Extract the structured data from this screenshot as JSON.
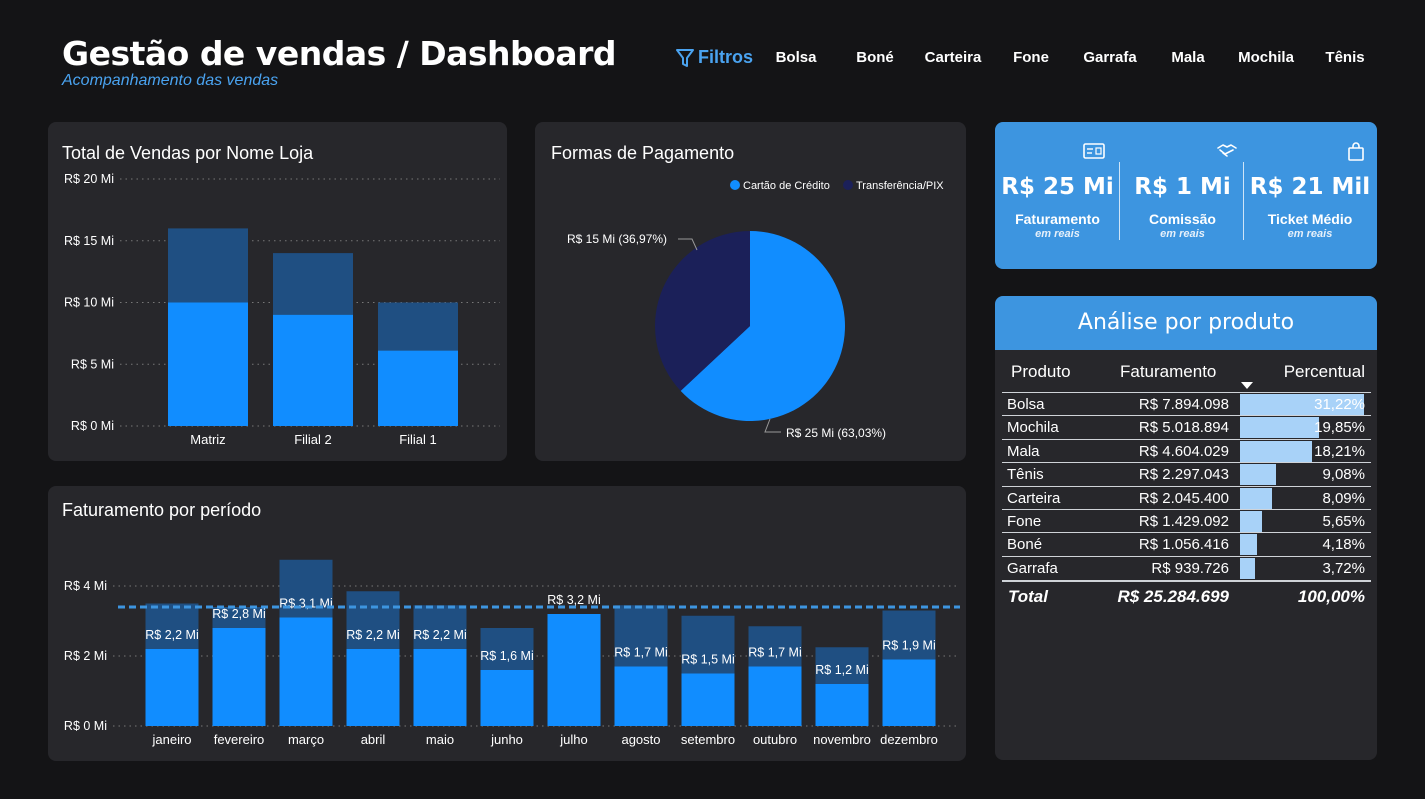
{
  "header": {
    "title": "Gestão de vendas / Dashboard",
    "subtitle": "Acompanhamento das vendas",
    "filter_label": "Filtros",
    "filters": [
      "Bolsa",
      "Boné",
      "Carteira",
      "Fone",
      "Garrafa",
      "Mala",
      "Mochila",
      "Tênis"
    ]
  },
  "colors": {
    "background": "#141416",
    "card": "#27272b",
    "accent": "#3d95e0",
    "bar": "#118dff",
    "bar_dark": "#1f4f82",
    "navy": "#1b2059"
  },
  "stores_chart": {
    "title": "Total de Vendas por Nome Loja",
    "y_ticks": [
      "R$ 20 Mi",
      "R$ 15 Mi",
      "R$ 10 Mi",
      "R$ 5 Mi",
      "R$ 0 Mi"
    ]
  },
  "payment_chart": {
    "title": "Formas de Pagamento",
    "legend": [
      "Cartão de Crédito",
      "Transferência/PIX"
    ],
    "label_credit": "R$ 25 Mi (63,03%)",
    "label_pix": "R$ 15 Mi (36,97%)"
  },
  "period_chart": {
    "title": "Faturamento por período",
    "y_ticks": [
      "R$ 4 Mi",
      "R$ 2 Mi",
      "R$ 0 Mi"
    ]
  },
  "chart_data": [
    {
      "type": "bar",
      "title": "Total de Vendas por Nome Loja",
      "categories": [
        "Matriz",
        "Filial 2",
        "Filial 1"
      ],
      "series": [
        {
          "values": [
            10.0,
            9.0,
            6.1
          ]
        },
        {
          "values": [
            16.0,
            14.0,
            10.0
          ]
        }
      ],
      "ylim": [
        0,
        20
      ],
      "y_unit": "Mi",
      "grid": true
    },
    {
      "type": "pie",
      "title": "Formas de Pagamento",
      "categories": [
        "Cartão de Crédito",
        "Transferência/PIX"
      ],
      "values": [
        63.03,
        36.97
      ],
      "labels": [
        "R$ 25 Mi (63,03%)",
        "R$ 15 Mi (36,97%)"
      ],
      "legend": "top-right"
    },
    {
      "type": "bar",
      "title": "Faturamento por período",
      "categories": [
        "janeiro",
        "fevereiro",
        "março",
        "abril",
        "maio",
        "junho",
        "julho",
        "agosto",
        "setembro",
        "outubro",
        "novembro",
        "dezembro"
      ],
      "series": [
        {
          "values": [
            2.2,
            2.8,
            3.1,
            2.2,
            2.2,
            1.6,
            3.2,
            1.7,
            1.5,
            1.7,
            1.2,
            1.9
          ]
        },
        {
          "values": [
            3.5,
            3.4,
            4.75,
            3.85,
            3.45,
            2.8,
            3.2,
            3.45,
            3.15,
            2.85,
            2.25,
            3.3
          ]
        }
      ],
      "data_labels": [
        "R$ 2,2 Mi",
        "R$ 2,8 Mi",
        "R$ 3,1 Mi",
        "R$ 2,2 Mi",
        "R$ 2,2 Mi",
        "R$ 1,6 Mi",
        "R$ 3,2 Mi",
        "R$ 1,7 Mi",
        "R$ 1,5 Mi",
        "R$ 1,7 Mi",
        "R$ 1,2 Mi",
        "R$ 1,9 Mi"
      ],
      "reference_line": 3.4,
      "ylim": [
        0,
        5
      ],
      "grid": true
    }
  ],
  "kpis": [
    {
      "icon": "card-icon",
      "value": "R$ 25 Mi",
      "label": "Faturamento",
      "sub": "em reais"
    },
    {
      "icon": "handshake-icon",
      "value": "R$ 1 Mi",
      "label": "Comissão",
      "sub": "em reais"
    },
    {
      "icon": "shopping-bag-icon",
      "value": "R$ 21 Mil",
      "label": "Ticket Médio",
      "sub": "em reais"
    }
  ],
  "product_table": {
    "title": "Análise por produto",
    "columns": [
      "Produto",
      "Faturamento",
      "Percentual"
    ],
    "rows": [
      {
        "produto": "Bolsa",
        "faturamento": "R$ 7.894.098",
        "percentual": "31,22%",
        "share": 31.22
      },
      {
        "produto": "Mochila",
        "faturamento": "R$ 5.018.894",
        "percentual": "19,85%",
        "share": 19.85
      },
      {
        "produto": "Mala",
        "faturamento": "R$ 4.604.029",
        "percentual": "18,21%",
        "share": 18.21
      },
      {
        "produto": "Tênis",
        "faturamento": "R$ 2.297.043",
        "percentual": "9,08%",
        "share": 9.08
      },
      {
        "produto": "Carteira",
        "faturamento": "R$ 2.045.400",
        "percentual": "8,09%",
        "share": 8.09
      },
      {
        "produto": "Fone",
        "faturamento": "R$ 1.429.092",
        "percentual": "5,65%",
        "share": 5.65
      },
      {
        "produto": "Boné",
        "faturamento": "R$ 1.056.416",
        "percentual": "4,18%",
        "share": 4.18
      },
      {
        "produto": "Garrafa",
        "faturamento": "R$ 939.726",
        "percentual": "3,72%",
        "share": 3.72
      }
    ],
    "total": {
      "produto": "Total",
      "faturamento": "R$ 25.284.699",
      "percentual": "100,00%"
    }
  }
}
